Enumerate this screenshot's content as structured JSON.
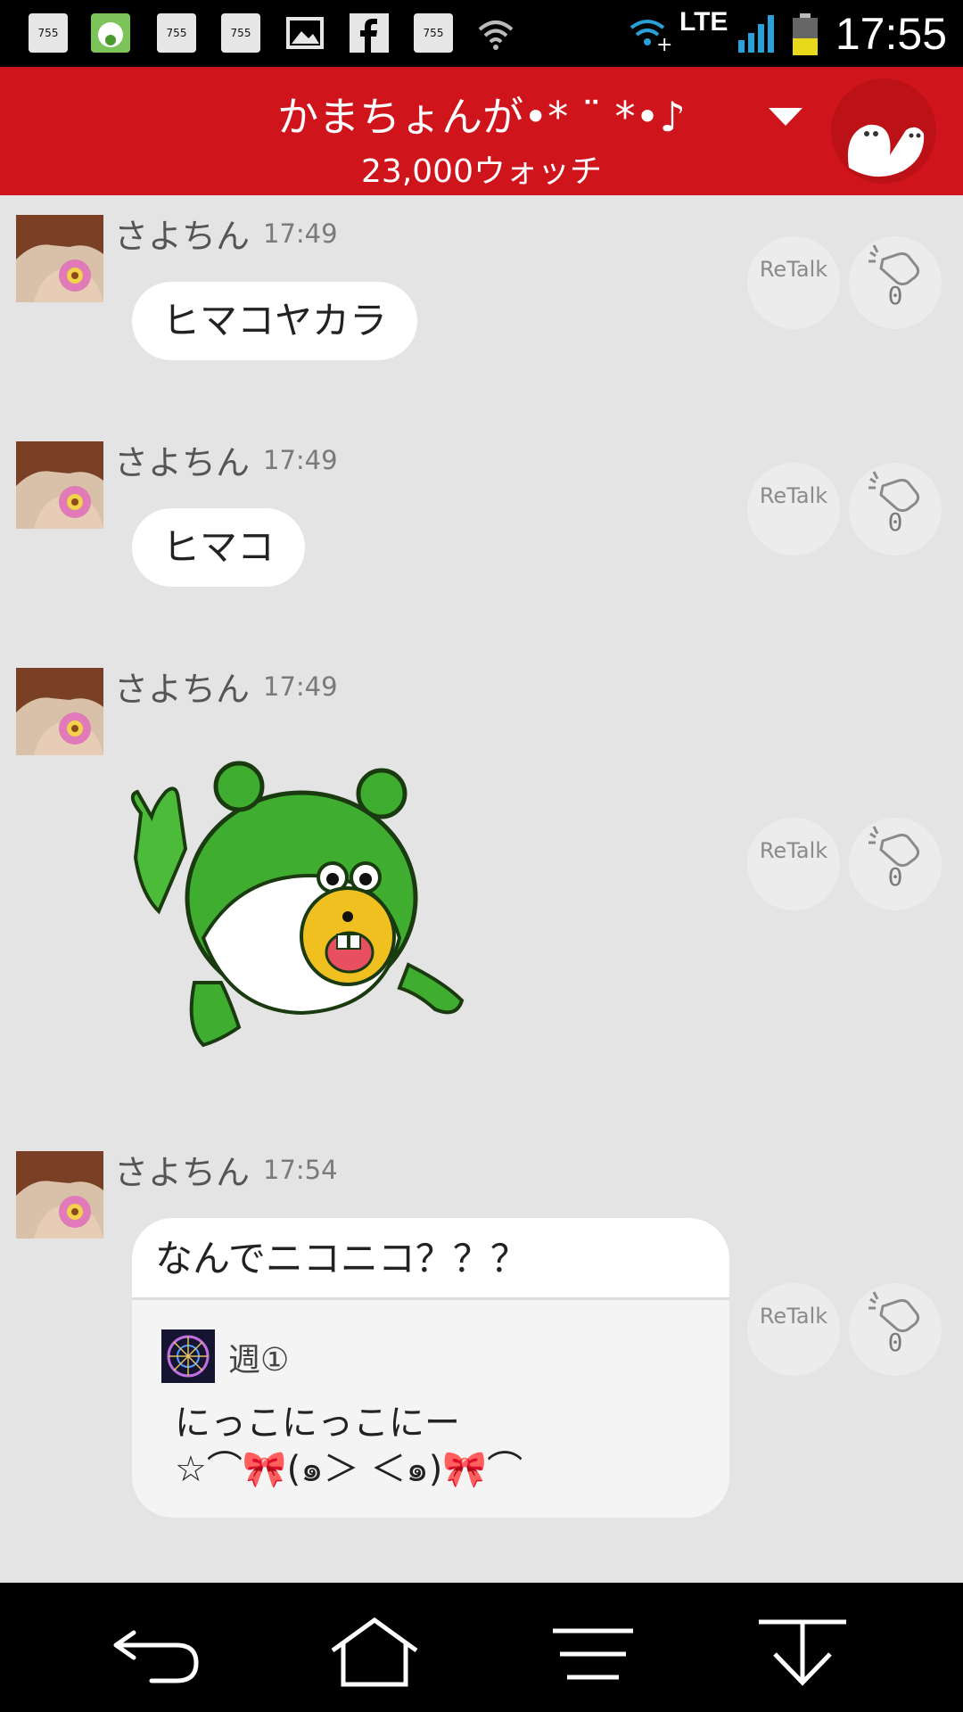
{
  "status_bar": {
    "notification_icons": [
      "755-icon",
      "voices-app-icon",
      "755-icon",
      "755-icon",
      "image-icon",
      "facebook-icon",
      "755-icon",
      "wifi-icon"
    ],
    "notif_label": "755",
    "network": "LTE",
    "time": "17:55"
  },
  "header": {
    "title": "かまちょんが•* ¨ *•♪",
    "watch_count": "23,000ウォッチ"
  },
  "messages": [
    {
      "user": "さよちん",
      "time": "17:49",
      "text": "ヒマコヤカラ",
      "retalk": "ReTalk",
      "claps": "0"
    },
    {
      "user": "さよちん",
      "time": "17:49",
      "text": "ヒマコ",
      "retalk": "ReTalk",
      "claps": "0"
    },
    {
      "user": "さよちん",
      "time": "17:49",
      "sticker": "green-bear-sticker",
      "retalk": "ReTalk",
      "claps": "0"
    },
    {
      "user": "さよちん",
      "time": "17:54",
      "text": "なんでニコニコ？？？",
      "quote": {
        "user": "週①",
        "line1": "にっこにっこにー",
        "line2": "☆⌒🎀(๑＞ ＜๑)🎀⌒"
      },
      "retalk": "ReTalk",
      "claps": "0"
    }
  ],
  "colors": {
    "header": "#d0141c",
    "background": "#e4e4e4",
    "bubble": "#ffffff"
  }
}
